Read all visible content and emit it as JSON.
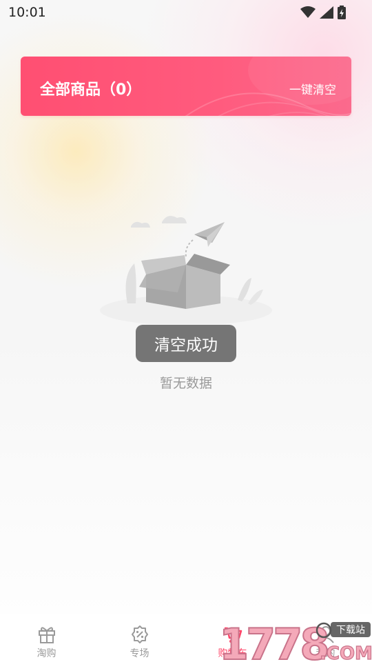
{
  "status_bar": {
    "time": "10:01"
  },
  "header": {
    "title": "全部商品（0）",
    "clear_all_label": "一键清空"
  },
  "empty_state": {
    "toast": "清空成功",
    "message": "暂无数据"
  },
  "bottom_nav": {
    "items": [
      {
        "label": "淘购",
        "icon": "gift-icon"
      },
      {
        "label": "专场",
        "icon": "discount-icon"
      },
      {
        "label": "购物车",
        "icon": "cart-icon",
        "active": true
      },
      {
        "label": "我的",
        "icon": "user-icon"
      }
    ]
  },
  "watermark": {
    "brand": "1778",
    "suffix": ".COM",
    "badge": "下载站"
  },
  "colors": {
    "accent": "#ff4f72",
    "active_nav": "#ff4468",
    "inactive_nav": "#9a9a9a"
  }
}
